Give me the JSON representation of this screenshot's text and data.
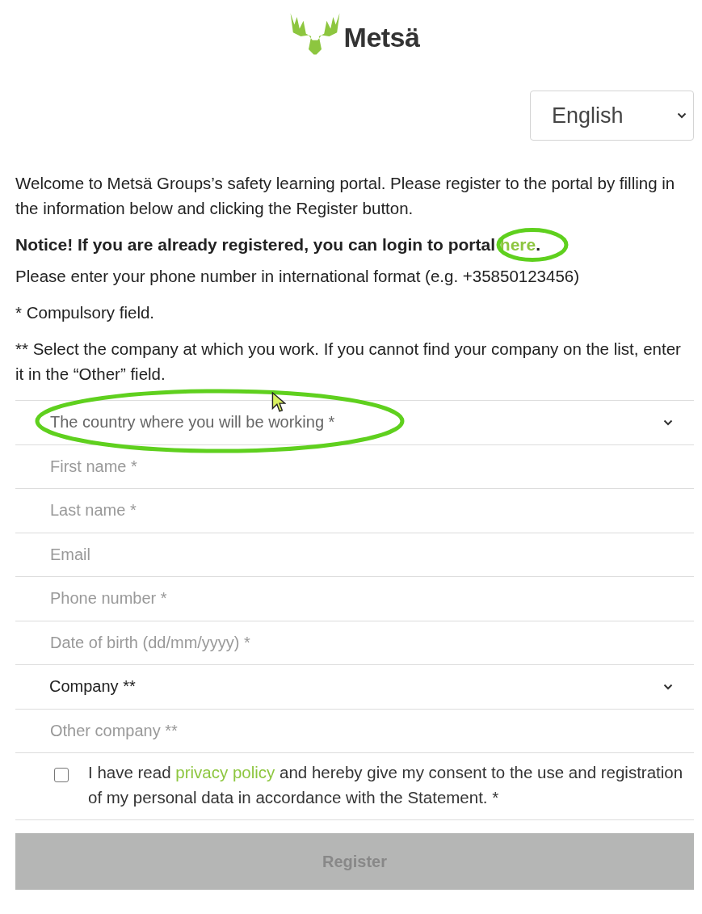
{
  "logo": {
    "text": "Metsä"
  },
  "language_select": {
    "value": "English"
  },
  "intro": {
    "welcome": "Welcome to Metsä Groups’s safety learning portal. Please register to the portal by filling in the information below and clicking the Register button.",
    "notice": "Notice! If you are already registered, you can login to portal ",
    "notice_link": "here",
    "notice_end": ".",
    "phone_hint": "Please enter your phone number in international format (e.g. +35850123456)",
    "compulsory": "* Compulsory field.",
    "company_hint": "** Select the company at which you work. If you cannot find your company on the list, enter it in the “Other” field."
  },
  "fields": [
    {
      "kind": "select",
      "label": "The country where you will be working *",
      "chosen": false
    },
    {
      "kind": "input",
      "placeholder": "First name *"
    },
    {
      "kind": "input",
      "placeholder": "Last name *"
    },
    {
      "kind": "input",
      "placeholder": "Email"
    },
    {
      "kind": "input",
      "placeholder": "Phone number *"
    },
    {
      "kind": "input",
      "placeholder": "Date of birth (dd/mm/yyyy) *"
    },
    {
      "kind": "select",
      "label": "Company **",
      "chosen": true
    },
    {
      "kind": "input",
      "placeholder": "Other company **"
    }
  ],
  "consent": {
    "checked": false,
    "before": "I have read ",
    "link": "privacy policy",
    "after": " and hereby give my consent to the use and registration of my personal data in accordance with the Statement. *"
  },
  "register_button": {
    "label": "Register",
    "disabled": true
  }
}
